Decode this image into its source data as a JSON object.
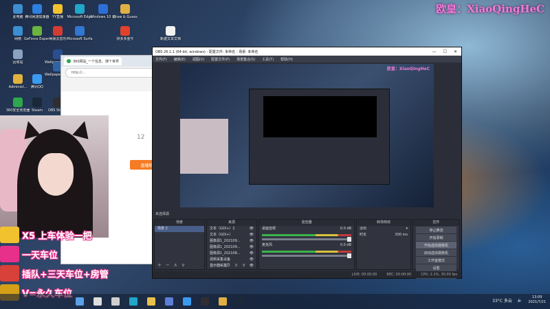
{
  "fan_label": "欧皇：XiaoQingHeC",
  "desktop_icons": [
    {
      "label": "此电脑",
      "color": "#3b8ed0"
    },
    {
      "label": "腾讯网游加速器",
      "color": "#2d7fe0"
    },
    {
      "label": "YY直播",
      "color": "#f2c12e"
    },
    {
      "label": "Microsoft Edge",
      "color": "#1fa6c9"
    },
    {
      "label": "Windows 10 易升",
      "color": "#2d6fd6"
    },
    {
      "label": "Draw & Guess",
      "color": "#e0b044"
    },
    {
      "label": "网络",
      "color": "#3b8ed0"
    },
    {
      "label": "GeForce Experience",
      "color": "#6cb33f"
    },
    {
      "label": "网易云音乐",
      "color": "#d43c33"
    },
    {
      "label": "Microsoft Surfa...",
      "color": "#3277d1"
    },
    {
      "label": "Wallpaper Engine",
      "color": "#2a4e8f"
    },
    {
      "label": "拼多多金牛",
      "color": "#e2422c"
    },
    {
      "label": "回收站",
      "color": "#8aa2bf"
    },
    {
      "label": "Wallpaper Engine：壁纸...",
      "color": "#3063a5"
    },
    {
      "label": "Administ...",
      "color": "#e3b23c"
    },
    {
      "label": "腾讯QQ",
      "color": "#3a9af0"
    },
    {
      "label": "360安全浏览器",
      "color": "#2fa74d"
    },
    {
      "label": "Steam",
      "color": "#1b2838"
    },
    {
      "label": "OBS Studio",
      "color": "#302e31"
    },
    {
      "label": "新建文本文档",
      "color": "#f2f2f2"
    }
  ],
  "browser": {
    "tab_title": "360网站_一个信息、搜个世界",
    "address": "http://...",
    "live_button": "直播助手",
    "number": "12"
  },
  "obs": {
    "title": "OBS 26.1.1 (64-bit, windows) - 配置文件: 未命名 - 场景: 未命名",
    "menu": [
      "文件(F)",
      "编辑(E)",
      "视图(V)",
      "配置文件(P)",
      "场景集合(S)",
      "工具(T)",
      "帮助(H)"
    ],
    "no_source": "未选择源",
    "scenes_header": "场景",
    "scenes": [
      "场景 2"
    ],
    "sources_header": "来源",
    "sources": [
      "文本（GDI+）2",
      "文本（GDI+）",
      "图像源1_202109...",
      "图像源1_202109...",
      "图像源1_202108...",
      "视频采集设备",
      "显示器采集"
    ],
    "mixer_header": "混音器",
    "mixer": [
      {
        "name": "桌面音频",
        "db": "0.0 dB"
      },
      {
        "name": "麦克风",
        "db": "0.0 dB"
      }
    ],
    "transition_header": "转场特效",
    "transition_name": "淡出",
    "duration_label": "时长",
    "duration_value": "300 ms",
    "controls_header": "控件",
    "controls": [
      "停止推流",
      "开始录制",
      "开始虚拟摄像机",
      "启动虚拟摄像机",
      "工作室模式",
      "设置",
      "退出"
    ],
    "status": {
      "live": "LIVE: 00:00:00",
      "rec": "REC: 00:00:00",
      "cpu": "CPU: 2.1%, 30.00 fps"
    },
    "preview_fan_label": "欧皇：XiaoQingHeC"
  },
  "promo": [
    {
      "text": "X5 上车体验一把",
      "color": "#f2c12e"
    },
    {
      "text": "一天车位",
      "color": "#e7308a"
    },
    {
      "text": "插队+三天车位+房管",
      "color": "#d8403a"
    },
    {
      "text": "V=永久车位",
      "color": "#d4a017"
    }
  ],
  "taskbar": {
    "icons": [
      "start",
      "search",
      "taskview",
      "edge",
      "explorer",
      "store",
      "qq",
      "obs",
      "chrome",
      "steam"
    ],
    "weather": "33°C 多云",
    "time": "13:09",
    "date": "2021/7/21"
  }
}
